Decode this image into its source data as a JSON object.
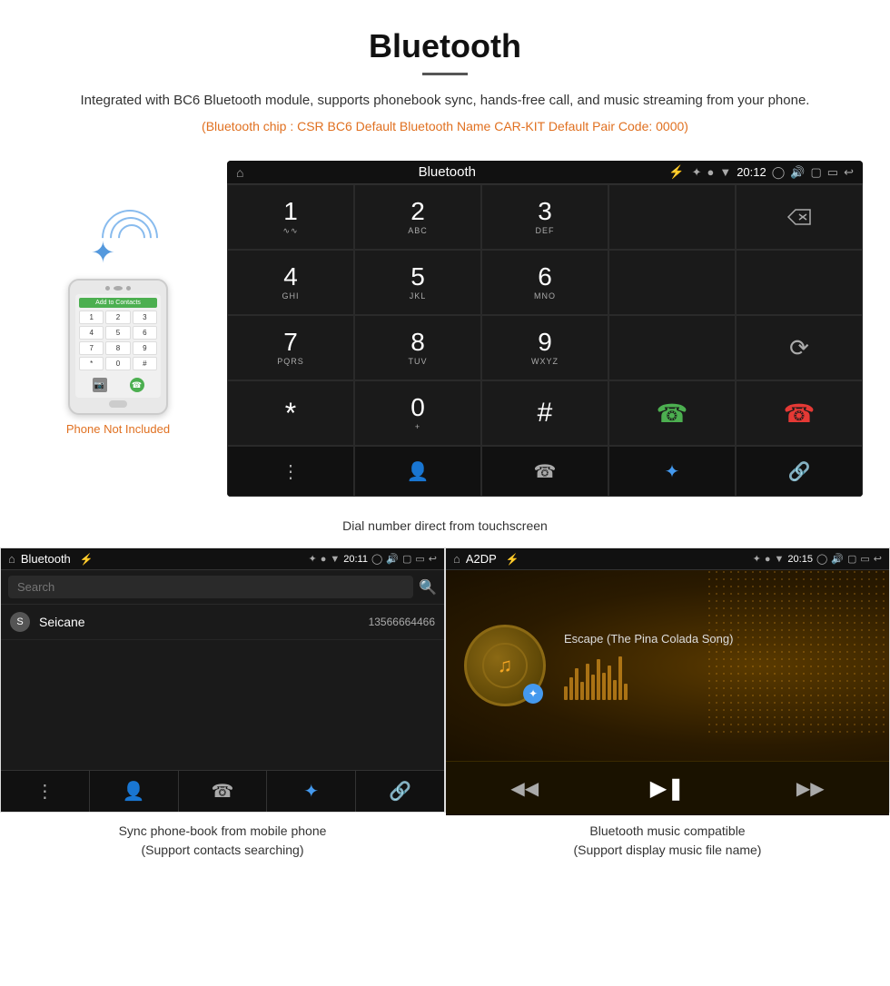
{
  "header": {
    "title": "Bluetooth",
    "description": "Integrated with BC6 Bluetooth module, supports phonebook sync, hands-free call, and music streaming from your phone.",
    "specs": "(Bluetooth chip : CSR BC6    Default Bluetooth Name CAR-KIT    Default Pair Code: 0000)"
  },
  "dial_screen": {
    "status_bar": {
      "title": "Bluetooth",
      "time": "20:12"
    },
    "keys": [
      {
        "num": "1",
        "sub": ""
      },
      {
        "num": "2",
        "sub": "ABC"
      },
      {
        "num": "3",
        "sub": "DEF"
      },
      {
        "num": "4",
        "sub": "GHI"
      },
      {
        "num": "5",
        "sub": "JKL"
      },
      {
        "num": "6",
        "sub": "MNO"
      },
      {
        "num": "7",
        "sub": "PQRS"
      },
      {
        "num": "8",
        "sub": "TUV"
      },
      {
        "num": "9",
        "sub": "WXYZ"
      },
      {
        "num": "*",
        "sub": ""
      },
      {
        "num": "0",
        "sub": "+"
      },
      {
        "num": "#",
        "sub": ""
      }
    ],
    "caption": "Dial number direct from touchscreen"
  },
  "phone_graphic": {
    "not_included": "Phone Not Included",
    "screen_header": "Add to Contacts"
  },
  "phonebook_screen": {
    "status_bar": {
      "title": "Bluetooth",
      "time": "20:11"
    },
    "search_placeholder": "Search",
    "contacts": [
      {
        "letter": "S",
        "name": "Seicane",
        "number": "13566664466"
      }
    ]
  },
  "music_screen": {
    "status_bar": {
      "title": "A2DP",
      "time": "20:15"
    },
    "song_title": "Escape (The Pina Colada Song)"
  },
  "captions": {
    "phonebook": "Sync phone-book from mobile phone\n(Support contacts searching)",
    "phonebook_line1": "Sync phone-book from mobile phone",
    "phonebook_line2": "(Support contacts searching)",
    "music_line1": "Bluetooth music compatible",
    "music_line2": "(Support display music file name)"
  }
}
